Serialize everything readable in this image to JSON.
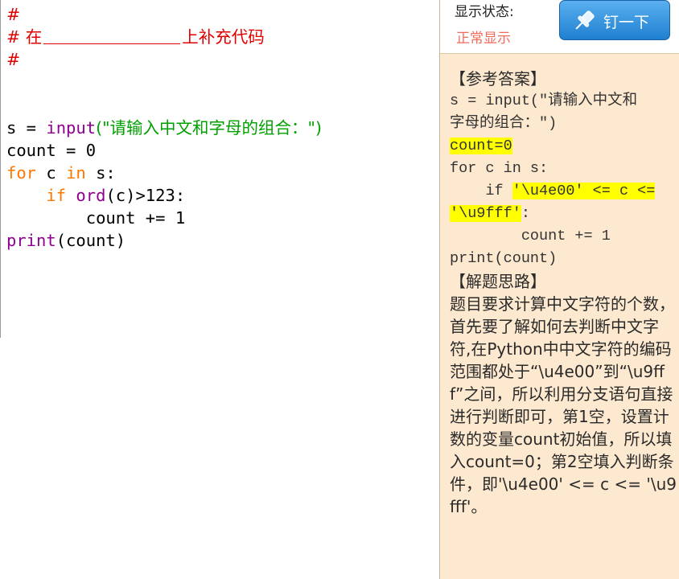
{
  "editor": {
    "comment_1": "#",
    "comment_2_prefix": "# 在",
    "comment_2_suffix": "上补充代码",
    "comment_3": "#",
    "line_1_var": "s = ",
    "line_1_func": "input",
    "line_1_str": "(\"请输入中文和字母的组合：\")",
    "line_2": "count = 0",
    "line_3_kw1": "for",
    "line_3_mid": " c ",
    "line_3_kw2": "in",
    "line_3_end": " s:",
    "line_4_indent": "    ",
    "line_4_kw": "if",
    "line_4_space": " ",
    "line_4_func": "ord",
    "line_4_end": "(c)>123:",
    "line_5": "        count += 1",
    "line_6_func": "print",
    "line_6_end": "(count)"
  },
  "panel": {
    "status_label": "显示状态:",
    "status_value": "正常显示",
    "pin_button_label": "钉一下",
    "answer_heading": "【参考答案】",
    "code_1": "s = input(\"请输入中文和",
    "code_2": "字母的组合：\")",
    "code_3": "count=0",
    "code_4_pre": "for c in s:",
    "code_5_pre": "    if ",
    "code_5_hl": "'\\u4e00' <= c <=",
    "code_6_hl": "'\\u9fff'",
    "code_6_post": ":",
    "code_7": "        count += 1",
    "code_8": "print(count)",
    "thinking_heading": "【解题思路】",
    "thinking_text": "题目要求计算中文字符的个数，首先要了解如何去判断中文字符,在Python中中文字符的编码范围都处于“\\u4e00”到“\\u9fff”之间，所以利用分支语句直接进行判断即可，第1空，设置计数的变量count初始值，所以填入count=0；第2空填入判断条件，即'\\u4e00' <= c <= '\\u9fff'。"
  },
  "icons": {
    "pin": "pin-icon"
  },
  "colors": {
    "comment_red": "#e00000",
    "keyword_orange": "#ff7700",
    "builtin_purple": "#900090",
    "string_green": "#00a000",
    "panel_bg": "#fde9cf",
    "button_blue": "#1f7fd0",
    "highlight": "#ffff00"
  }
}
